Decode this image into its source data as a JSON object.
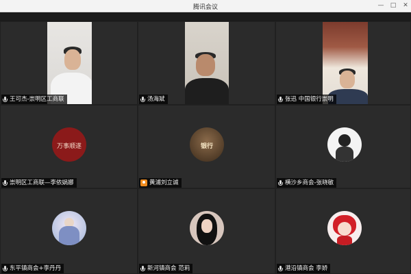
{
  "window": {
    "title": "腾讯会议",
    "controls": {
      "minimize": "—",
      "maximize": "□",
      "close": "✕"
    }
  },
  "participants": [
    {
      "name": "王可杰-崇明区工商联",
      "mic": "on",
      "type": "video"
    },
    {
      "name": "汤海斌",
      "mic": "on",
      "type": "video"
    },
    {
      "name": "张迅 中国银行崇明",
      "mic": "on",
      "type": "video"
    },
    {
      "name": "崇明区工商联—李依娲娜",
      "mic": "on",
      "type": "avatar",
      "avatar_color": "#8b1a1a",
      "avatar_text": "万事顺遂"
    },
    {
      "name": "黄浦刘立诚",
      "mic": "host",
      "type": "avatar",
      "avatar_color": "#6b4b2e",
      "avatar_text": "银行"
    },
    {
      "name": "横沙乡商会-张晓敏",
      "mic": "on",
      "type": "avatar",
      "avatar_color": "#f4f4f4",
      "avatar_text": ""
    },
    {
      "name": "东平镇商会+李丹丹",
      "mic": "on",
      "type": "avatar",
      "avatar_color": "#b7c7e6",
      "avatar_text": ""
    },
    {
      "name": "新河镇商会 范莉",
      "mic": "on",
      "type": "avatar",
      "avatar_color": "#d8b8a8",
      "avatar_text": ""
    },
    {
      "name": "港沿镇商会 李娇",
      "mic": "on",
      "type": "avatar",
      "avatar_color": "#f1e3e3",
      "avatar_text": ""
    }
  ]
}
